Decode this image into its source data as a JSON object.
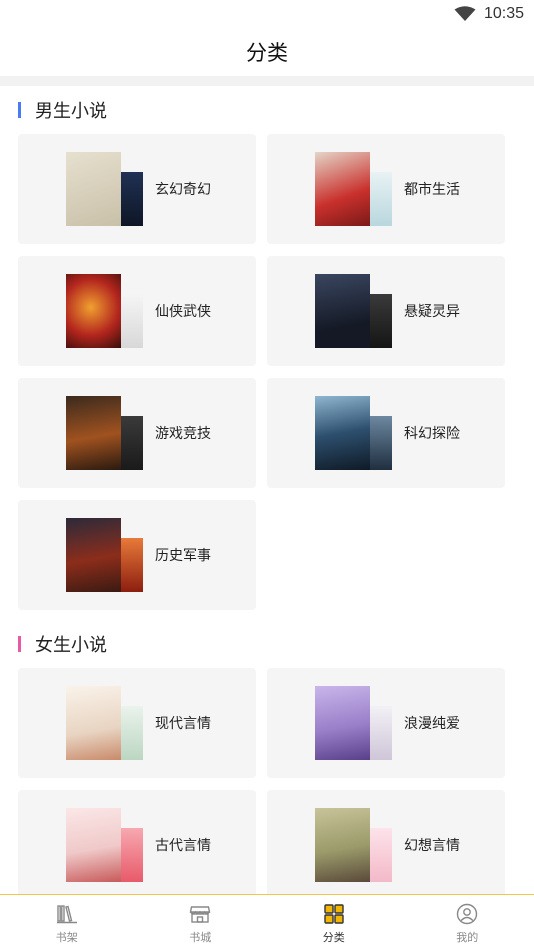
{
  "status_bar": {
    "time": "10:35",
    "wifi_icon": "wifi-icon"
  },
  "header": {
    "title": "分类"
  },
  "sections": [
    {
      "title": "男生小说",
      "accent_color": "#4a7bf7",
      "categories": [
        {
          "label": "玄幻奇幻",
          "cover_colors": [
            "#d9d2bf",
            "#1c2a44"
          ]
        },
        {
          "label": "都市生活",
          "cover_colors": [
            "#c9302c",
            "#cfe4ea"
          ]
        },
        {
          "label": "仙侠武侠",
          "cover_colors": [
            "#b3261e",
            "#e9e9e9"
          ]
        },
        {
          "label": "悬疑灵异",
          "cover_colors": [
            "#1d2330",
            "#2b2b2b"
          ]
        },
        {
          "label": "游戏竞技",
          "cover_colors": [
            "#6b3a1c",
            "#2a2a2a"
          ]
        },
        {
          "label": "科幻探险",
          "cover_colors": [
            "#2d4f6e",
            "#3f5c78"
          ]
        },
        {
          "label": "历史军事",
          "cover_colors": [
            "#8c2d1b",
            "#c43d1e"
          ]
        }
      ]
    },
    {
      "title": "女生小说",
      "accent_color": "#e85aa8",
      "categories": [
        {
          "label": "现代言情",
          "cover_colors": [
            "#f1e7dc",
            "#d5e7d8"
          ]
        },
        {
          "label": "浪漫纯爱",
          "cover_colors": [
            "#9a7fc9",
            "#e8e3ee"
          ]
        },
        {
          "label": "古代言情",
          "cover_colors": [
            "#f0c9c9",
            "#e85a6a"
          ]
        },
        {
          "label": "幻想言情",
          "cover_colors": [
            "#9a9a6a",
            "#f3b9c8"
          ]
        }
      ]
    }
  ],
  "tab_bar": {
    "active_color": "#f2b705",
    "tabs": [
      {
        "label": "书架",
        "icon": "bookshelf-icon"
      },
      {
        "label": "书城",
        "icon": "store-icon"
      },
      {
        "label": "分类",
        "icon": "category-icon"
      },
      {
        "label": "我的",
        "icon": "profile-icon"
      }
    ]
  }
}
